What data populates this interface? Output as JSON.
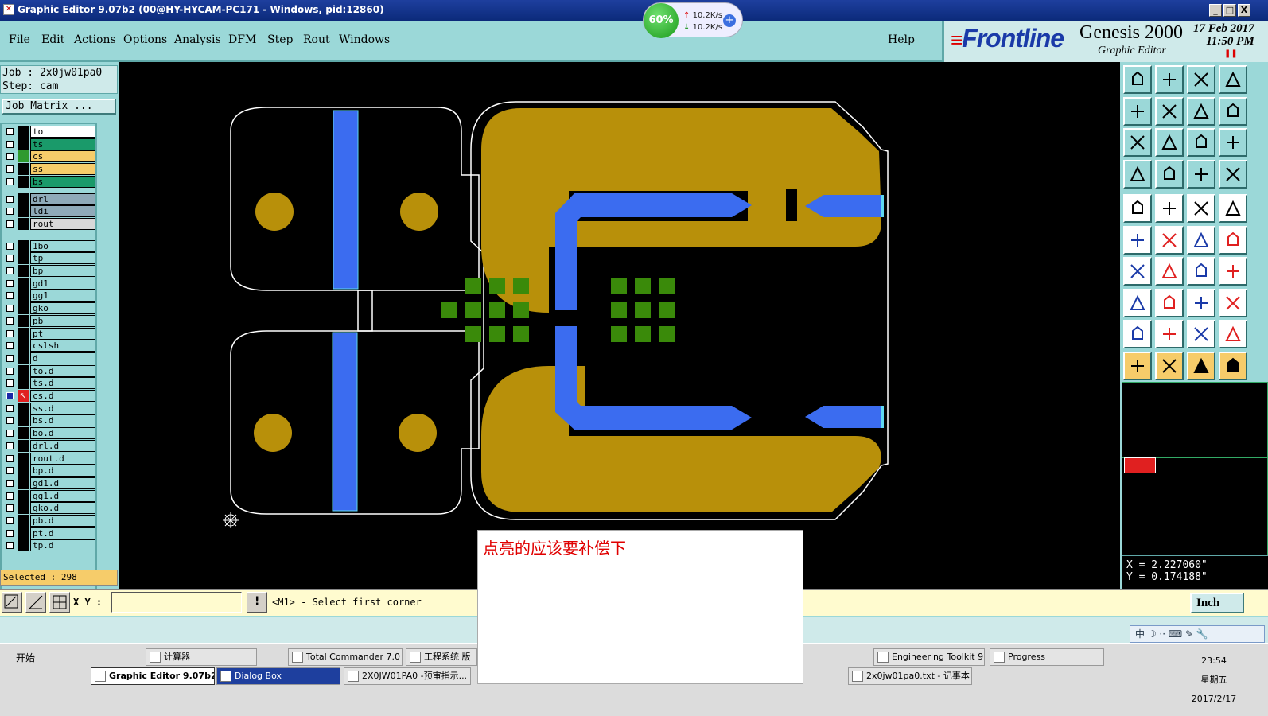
{
  "window": {
    "title": "Graphic Editor 9.07b2 (00@HY-HYCAM-PC171 - Windows, pid:12860)",
    "minimize": "_",
    "restore": "□",
    "close": "X"
  },
  "menu": {
    "items": [
      "File",
      "Edit",
      "Actions",
      "Options",
      "Analysis",
      "DFM",
      "Step",
      "Rout",
      "Windows"
    ],
    "help": "Help"
  },
  "brand": {
    "logo": "Frontline",
    "product": "Genesis 2000",
    "subtitle": "Graphic Editor",
    "date_line": "17 Feb 2017",
    "time": "11:50 PM"
  },
  "network_widget": {
    "percent": "60%",
    "upload": "10.2K/s",
    "download": "10.2K/s"
  },
  "job": {
    "job_label": "Job : 2x0jw01pa0",
    "step_label": "Step: cam",
    "matrix_button": "Job Matrix ..."
  },
  "layers": [
    {
      "name": "to",
      "color": "#ffffff",
      "affected": false
    },
    {
      "name": "ts",
      "color": "#1a9a6a",
      "affected": false
    },
    {
      "name": "cs",
      "color": "#f6cc6a",
      "affected": false,
      "swatch": "#2f9a2f"
    },
    {
      "name": "ss",
      "color": "#f6cc6a",
      "affected": false
    },
    {
      "name": "bs",
      "color": "#1a9a6a",
      "affected": false
    },
    {
      "name": "drl",
      "color": "#8faab8",
      "affected": false
    },
    {
      "name": "ldi",
      "color": "#8faab8",
      "affected": false
    },
    {
      "name": "rout",
      "color": "#d8d8d8",
      "affected": false
    },
    {
      "name": "1bo",
      "color": "#9bd8d8",
      "affected": false
    },
    {
      "name": "tp",
      "color": "#9bd8d8",
      "affected": false
    },
    {
      "name": "bp",
      "color": "#9bd8d8",
      "affected": false
    },
    {
      "name": "gd1",
      "color": "#9bd8d8",
      "affected": false
    },
    {
      "name": "gg1",
      "color": "#9bd8d8",
      "affected": false
    },
    {
      "name": "gko",
      "color": "#9bd8d8",
      "affected": false
    },
    {
      "name": "pb",
      "color": "#9bd8d8",
      "affected": false
    },
    {
      "name": "pt",
      "color": "#9bd8d8",
      "affected": false
    },
    {
      "name": "cslsh",
      "color": "#9bd8d8",
      "affected": false
    },
    {
      "name": "d",
      "color": "#9bd8d8",
      "affected": false
    },
    {
      "name": "to.d",
      "color": "#9bd8d8",
      "affected": false
    },
    {
      "name": "ts.d",
      "color": "#9bd8d8",
      "affected": false
    },
    {
      "name": "cs.d",
      "color": "#9bd8d8",
      "affected": true
    },
    {
      "name": "ss.d",
      "color": "#9bd8d8",
      "affected": false
    },
    {
      "name": "bs.d",
      "color": "#9bd8d8",
      "affected": false
    },
    {
      "name": "bo.d",
      "color": "#9bd8d8",
      "affected": false
    },
    {
      "name": "drl.d",
      "color": "#9bd8d8",
      "affected": false
    },
    {
      "name": "rout.d",
      "color": "#9bd8d8",
      "affected": false
    },
    {
      "name": "bp.d",
      "color": "#9bd8d8",
      "affected": false
    },
    {
      "name": "gd1.d",
      "color": "#9bd8d8",
      "affected": false
    },
    {
      "name": "gg1.d",
      "color": "#9bd8d8",
      "affected": false
    },
    {
      "name": "gko.d",
      "color": "#9bd8d8",
      "affected": false
    },
    {
      "name": "pb.d",
      "color": "#9bd8d8",
      "affected": false
    },
    {
      "name": "pt.d",
      "color": "#9bd8d8",
      "affected": false
    },
    {
      "name": "tp.d",
      "color": "#9bd8d8",
      "affected": false
    }
  ],
  "selected": "Selected : 298",
  "coordinates": {
    "x": "X = 2.227060\"",
    "y": "Y = 0.174188\""
  },
  "command": {
    "xy_label": "X Y :",
    "xy_value": "",
    "message": "<M1> - Select first corner",
    "units": "Inch"
  },
  "note": {
    "text": "点亮的应该要补偿下"
  },
  "ime": {
    "text": "中 ☽ ·· ⌨ ✎ 🔧"
  },
  "taskbar": {
    "start": "开始",
    "row1": [
      "计算器",
      "Total Commander 7.0 ...",
      "工程系统  版",
      "Engineering Toolkit 9....",
      "Progress"
    ],
    "row2": [
      "Graphic Editor 9.07b2 ...",
      "Dialog Box",
      "2X0JW01PA0 -预审指示...",
      "2x0jw01pa0.txt - 记事本"
    ],
    "clock_time": "23:54",
    "clock_day": "星期五",
    "clock_date": "2017/2/17"
  },
  "colors": {
    "panel": "#9bd8d8",
    "copper": "#b8900a",
    "trace": "#3b6cf0",
    "pad_green": "#3a8a0a",
    "outline": "#ffffff"
  }
}
